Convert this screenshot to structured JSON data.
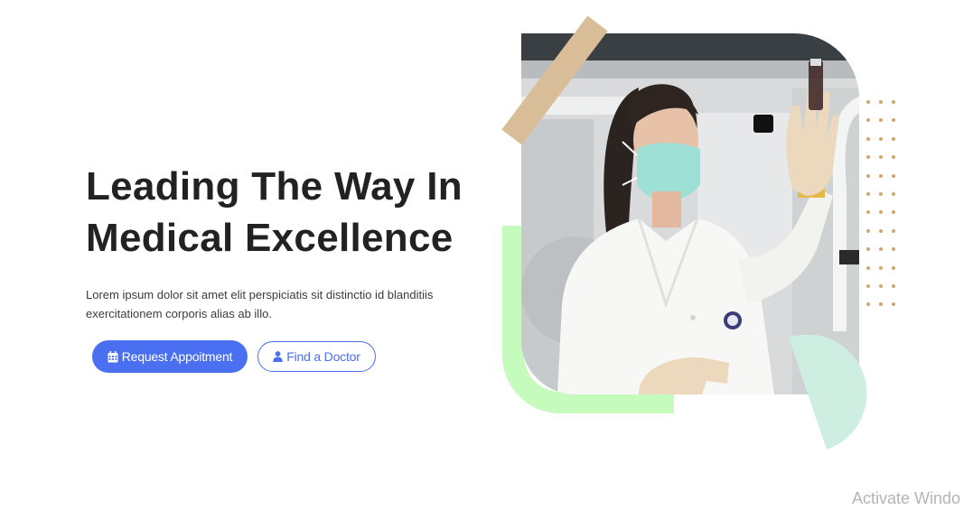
{
  "hero": {
    "title_line1": "Leading The Way In",
    "title_line2": "Medical Excellence",
    "description_line1": "Lorem ipsum dolor sit amet elit perspiciatis sit distinctio id blanditiis",
    "description_line2": "exercitationem corporis alias ab illo.",
    "primary_button_label": "Request Appoitment",
    "primary_button_icon": "calendar-icon",
    "secondary_button_label": "Find a Doctor",
    "secondary_button_icon": "user-icon"
  },
  "image": {
    "subject": "scientist-in-lab-coat-holding-vial",
    "alt": "Doctor examining a sample in a laboratory"
  },
  "colors": {
    "accent": "#4a6ff0",
    "title": "#222222",
    "deco_tan": "#d9bd98",
    "deco_green": "#c5fbbc",
    "deco_mint": "#cdeee0",
    "dots": "#d1a670"
  },
  "watermark": "Activate Windo"
}
